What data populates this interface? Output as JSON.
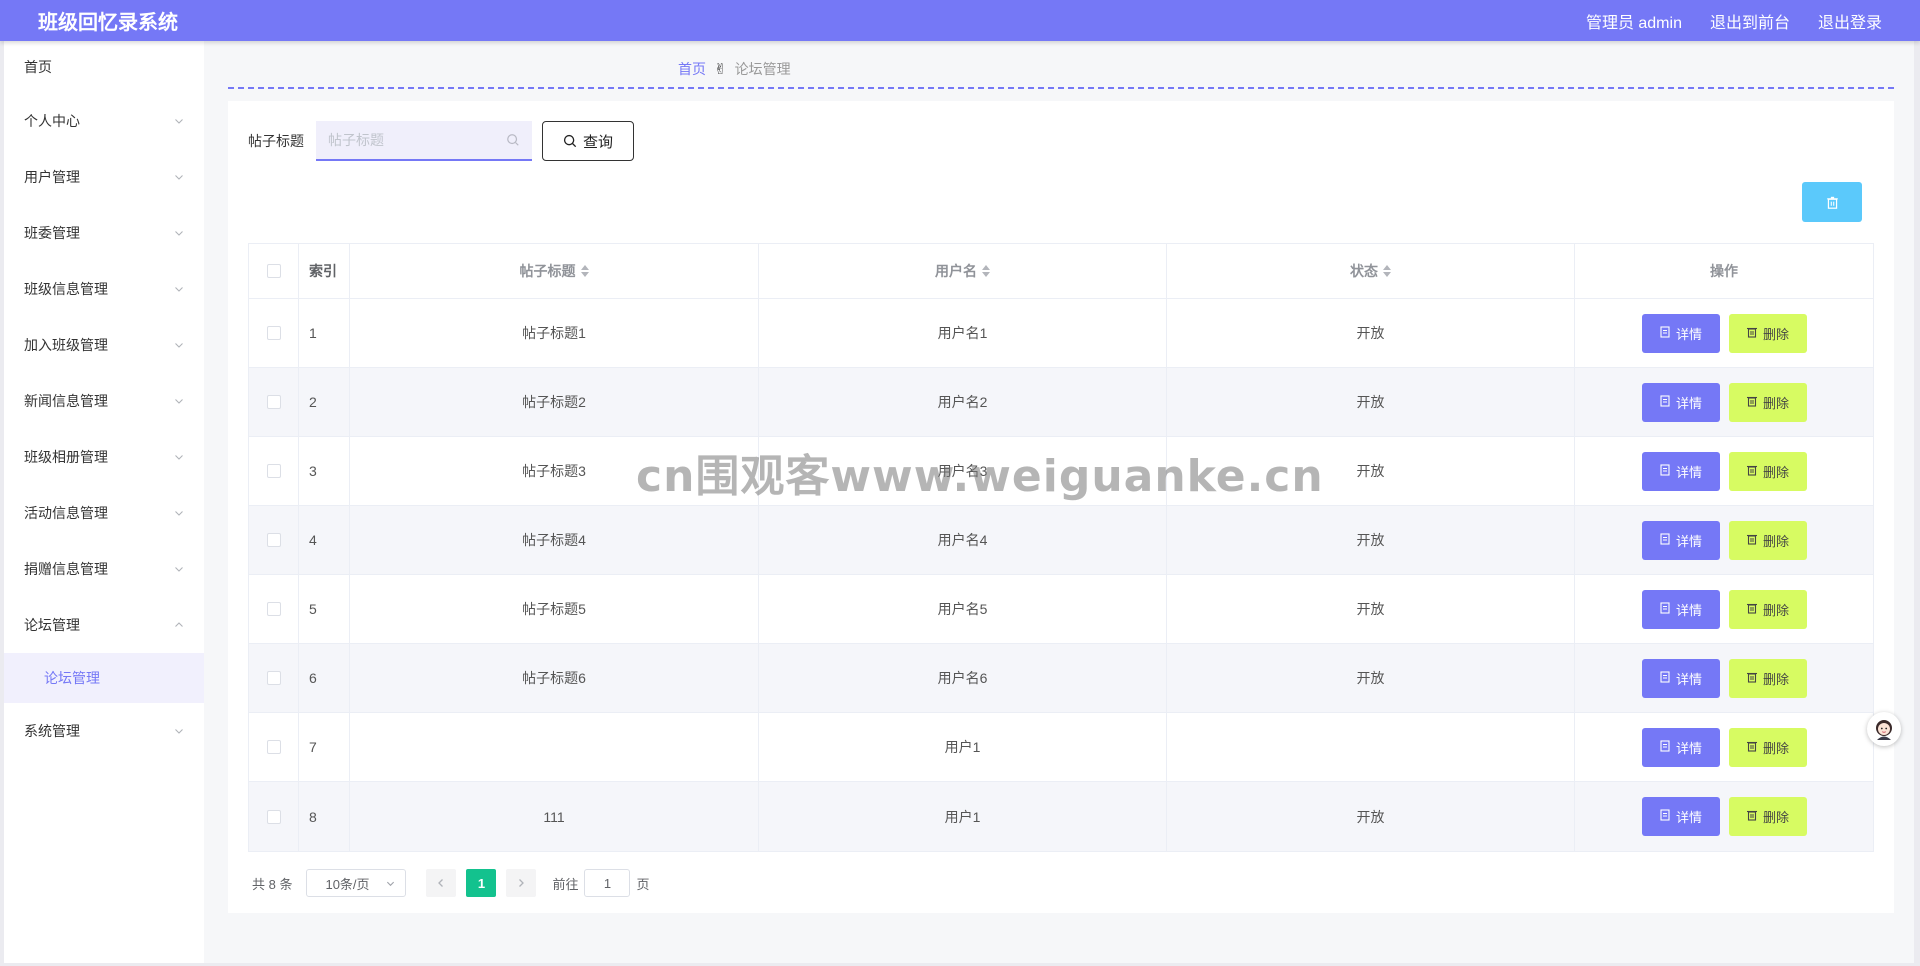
{
  "header": {
    "title": "班级回忆录系统",
    "user_label": "管理员 admin",
    "to_front": "退出到前台",
    "logout": "退出登录"
  },
  "sidebar": {
    "items": [
      {
        "label": "首页",
        "chevron": "none"
      },
      {
        "label": "个人中心",
        "chevron": "down"
      },
      {
        "label": "用户管理",
        "chevron": "down"
      },
      {
        "label": "班委管理",
        "chevron": "down"
      },
      {
        "label": "班级信息管理",
        "chevron": "down"
      },
      {
        "label": "加入班级管理",
        "chevron": "down"
      },
      {
        "label": "新闻信息管理",
        "chevron": "down"
      },
      {
        "label": "班级相册管理",
        "chevron": "down"
      },
      {
        "label": "活动信息管理",
        "chevron": "down"
      },
      {
        "label": "捐赠信息管理",
        "chevron": "down"
      },
      {
        "label": "论坛管理",
        "chevron": "up"
      },
      {
        "label": "系统管理",
        "chevron": "down"
      }
    ],
    "active_sub": "论坛管理"
  },
  "breadcrumb": {
    "home": "首页",
    "current": "论坛管理",
    "separator_icon": "hand-icon"
  },
  "search": {
    "label": "帖子标题",
    "placeholder": "帖子标题",
    "value": "",
    "button": "查询"
  },
  "table": {
    "headers": {
      "index": "索引",
      "title": "帖子标题",
      "username": "用户名",
      "status": "状态",
      "ops": "操作"
    },
    "detail_label": "详情",
    "delete_label": "删除",
    "rows": [
      {
        "index": "1",
        "title": "帖子标题1",
        "username": "用户名1",
        "status": "开放"
      },
      {
        "index": "2",
        "title": "帖子标题2",
        "username": "用户名2",
        "status": "开放"
      },
      {
        "index": "3",
        "title": "帖子标题3",
        "username": "用户名3",
        "status": "开放"
      },
      {
        "index": "4",
        "title": "帖子标题4",
        "username": "用户名4",
        "status": "开放"
      },
      {
        "index": "5",
        "title": "帖子标题5",
        "username": "用户名5",
        "status": "开放"
      },
      {
        "index": "6",
        "title": "帖子标题6",
        "username": "用户名6",
        "status": "开放"
      },
      {
        "index": "7",
        "title": "",
        "username": "用户1",
        "status": ""
      },
      {
        "index": "8",
        "title": "111",
        "username": "用户1",
        "status": "开放"
      }
    ]
  },
  "pagination": {
    "total": "共 8 条",
    "page_size": "10条/页",
    "current_page": "1",
    "goto_prefix": "前往",
    "goto_value": "1",
    "goto_suffix": "页"
  },
  "watermark": "cn围观客www.weiguanke.cn",
  "colors": {
    "primary": "#7578f6",
    "detail_btn": "#7578f6",
    "delete_btn": "#d7fb62",
    "batch_delete": "#5bc9fb",
    "page_active": "#13c28e"
  }
}
